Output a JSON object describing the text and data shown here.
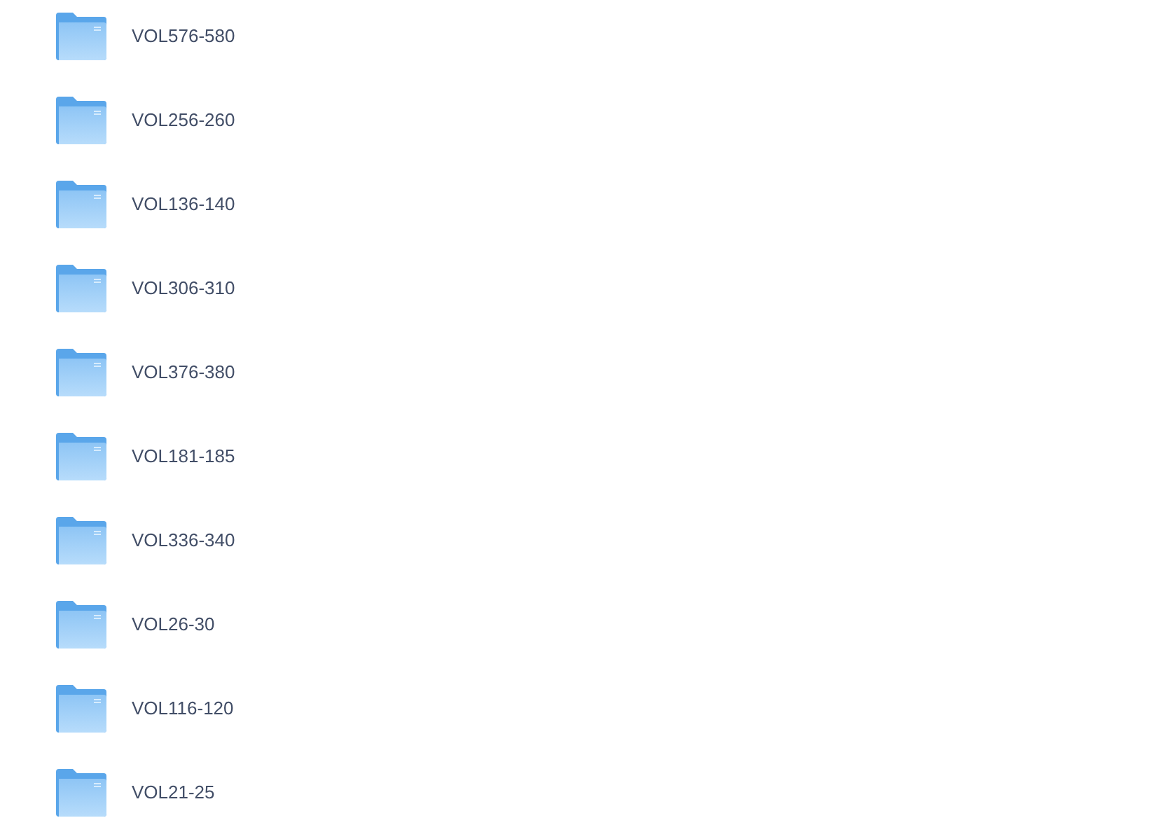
{
  "folders": [
    {
      "name": "VOL576-580"
    },
    {
      "name": "VOL256-260"
    },
    {
      "name": "VOL136-140"
    },
    {
      "name": "VOL306-310"
    },
    {
      "name": "VOL376-380"
    },
    {
      "name": "VOL181-185"
    },
    {
      "name": "VOL336-340"
    },
    {
      "name": "VOL26-30"
    },
    {
      "name": "VOL116-120"
    },
    {
      "name": "VOL21-25"
    }
  ]
}
